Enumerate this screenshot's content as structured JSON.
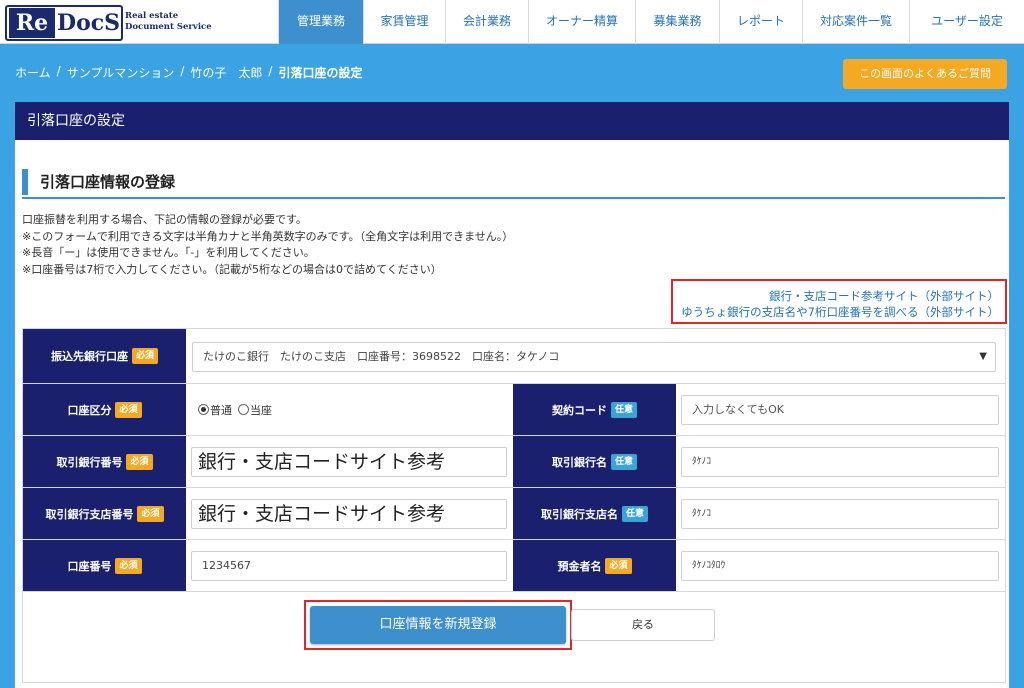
{
  "logo": {
    "re": "Re",
    "docs": "DocS",
    "tagline1": "Real estate",
    "tagline2": "Document Service"
  },
  "nav": [
    {
      "label": "管理業務",
      "active": true
    },
    {
      "label": "家賃管理"
    },
    {
      "label": "会計業務"
    },
    {
      "label": "オーナー精算"
    },
    {
      "label": "募集業務"
    },
    {
      "label": "レポート"
    },
    {
      "label": "対応案件一覧"
    },
    {
      "label": "ユーザー設定"
    }
  ],
  "breadcrumb": {
    "home": "ホーム",
    "building": "サンプルマンション",
    "owner": "竹の子　太郎",
    "current": "引落口座の設定",
    "separator": "/"
  },
  "faq_button": "この画面のよくあるご質問",
  "panel_title": "引落口座の設定",
  "section_title": "引落口座情報の登録",
  "notes": [
    "口座振替を利用する場合、下記の情報の登録が必要です。",
    "※このフォームで利用できる文字は半角カナと半角英数字のみです。（全角文字は利用できません。）",
    "※長音「ー」は使用できません。「-」を利用してください。",
    "※口座番号は7桁で入力してください。（記載が5桁などの場合は0で詰めてください）"
  ],
  "links": {
    "bank_code": "銀行・支店コード参考サイト（外部サイト）",
    "yucho": "ゆうちょ銀行の支店名や7桁口座番号を調べる（外部サイト）"
  },
  "badges": {
    "required": "必須",
    "optional": "任意"
  },
  "form": {
    "destination_account": {
      "label": "振込先銀行口座",
      "value": "たけのこ銀行　たけのこ支店　口座番号：3698522　口座名：タケノコ"
    },
    "account_type": {
      "label": "口座区分",
      "options": [
        "普通",
        "当座"
      ],
      "selected": "普通"
    },
    "contract_code": {
      "label": "契約コード",
      "placeholder": "入力しなくてもOK"
    },
    "bank_number": {
      "label": "取引銀行番号",
      "value": "銀行・支店コードサイト参考"
    },
    "bank_name": {
      "label": "取引銀行名",
      "value": "ﾀｹﾉｺ"
    },
    "branch_number": {
      "label": "取引銀行支店番号",
      "value": "銀行・支店コードサイト参考"
    },
    "branch_name": {
      "label": "取引銀行支店名",
      "value": "ﾀｹﾉｺ"
    },
    "account_number": {
      "label": "口座番号",
      "value": "1234567"
    },
    "holder_name": {
      "label": "預金者名",
      "value": "ﾀｹﾉｺﾀﾛｳ"
    }
  },
  "buttons": {
    "register": "口座情報を新規登録",
    "back": "戻る"
  },
  "colors": {
    "background": "#3ba3e3",
    "navy": "#1a1f6e",
    "accent": "#3e8fcd",
    "required": "#f4a922",
    "optional": "#3aa3d8",
    "highlight": "#e0262a"
  },
  "icons": {
    "select": "chevron-down-icon"
  }
}
